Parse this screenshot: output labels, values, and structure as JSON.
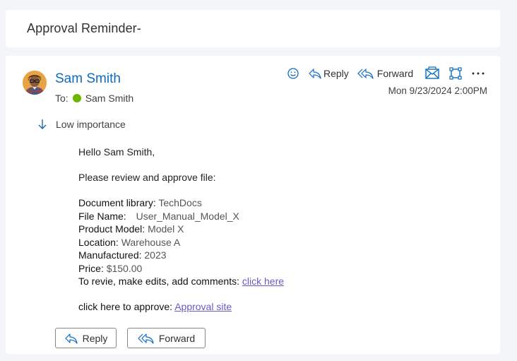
{
  "subject": "Approval Reminder-",
  "sender": {
    "name": "Sam Smith"
  },
  "to": {
    "label": "To:",
    "name": "Sam Smith"
  },
  "toolbar": {
    "reply_label": "Reply",
    "forward_label": "Forward"
  },
  "date": "Mon 9/23/2024 2:00PM",
  "importance": "Low importance",
  "body": {
    "greeting": "Hello Sam Smith,",
    "intro": "Please review and approve file:",
    "fields": {
      "doc_library_label": "Document library:",
      "doc_library_value": "TechDocs",
      "file_name_label": "File Name:",
      "file_name_value": "User_Manual_Model_X",
      "product_model_label": "Product Model:",
      "product_model_value": "Model X",
      "location_label": "Location:",
      "location_value": "Warehouse A",
      "manufactured_label": "Manufactured:",
      "manufactured_value": "2023",
      "price_label": "Price:",
      "price_value": "$150.00"
    },
    "edit_prompt": "To revie, make edits, add comments:",
    "edit_link": "click here",
    "approve_prompt": "click here to approve:",
    "approve_link": "Approval site"
  },
  "footer": {
    "reply_label": "Reply",
    "forward_label": "Forward"
  },
  "colors": {
    "accent": "#0f6cbd",
    "link": "#6e57c8",
    "presence": "#6bb700"
  },
  "icons": [
    "emoji-icon",
    "reply-icon",
    "forward-icon",
    "envelope-icon",
    "popout-icon",
    "more-icon",
    "low-importance-arrow-icon"
  ]
}
